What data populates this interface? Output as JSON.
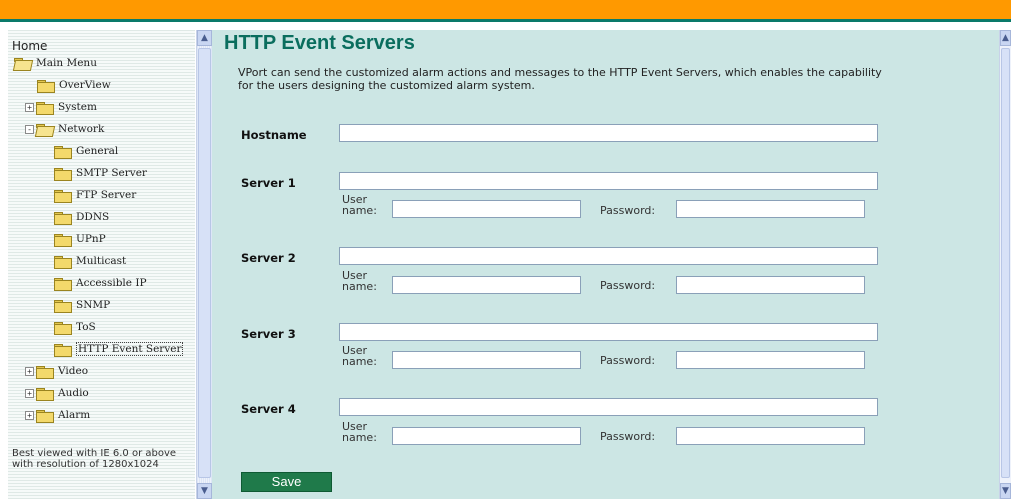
{
  "nav": {
    "home": "Home",
    "items": [
      {
        "label": "Main Menu"
      },
      {
        "label": "OverView"
      },
      {
        "label": "System",
        "expander": "+"
      },
      {
        "label": "Network",
        "expander": "-"
      },
      {
        "label": "General"
      },
      {
        "label": "SMTP Server"
      },
      {
        "label": "FTP Server"
      },
      {
        "label": "DDNS"
      },
      {
        "label": "UPnP"
      },
      {
        "label": "Multicast"
      },
      {
        "label": "Accessible IP"
      },
      {
        "label": "SNMP"
      },
      {
        "label": "ToS"
      },
      {
        "label": "HTTP Event Server"
      },
      {
        "label": "Video",
        "expander": "+"
      },
      {
        "label": "Audio",
        "expander": "+"
      },
      {
        "label": "Alarm",
        "expander": "+"
      }
    ],
    "note": "Best viewed with IE 6.0 or above with resolution of 1280x1024"
  },
  "page": {
    "title": "HTTP Event Servers",
    "description": "VPort can send the customized alarm actions and messages to the HTTP Event Servers, which enables the capability for the users designing the customized alarm system."
  },
  "form": {
    "hostname_label": "Hostname",
    "hostname_value": "",
    "user_label": "User name:",
    "password_label": "Password:",
    "servers": [
      {
        "label": "Server 1",
        "url": "",
        "user": "",
        "password": ""
      },
      {
        "label": "Server 2",
        "url": "",
        "user": "",
        "password": ""
      },
      {
        "label": "Server 3",
        "url": "",
        "user": "",
        "password": ""
      },
      {
        "label": "Server 4",
        "url": "",
        "user": "",
        "password": ""
      }
    ],
    "save_label": "Save"
  },
  "icons": {
    "tree": "folder-icon",
    "expander": "tree-expander-icon",
    "scroll_up": "scroll-up-arrow-icon",
    "scroll_down": "scroll-down-arrow-icon"
  },
  "colors": {
    "top_bar": "#ff9900",
    "content_bg": "#cce6e4",
    "title": "#0a6e5e",
    "save_button": "#1f7a4a"
  }
}
